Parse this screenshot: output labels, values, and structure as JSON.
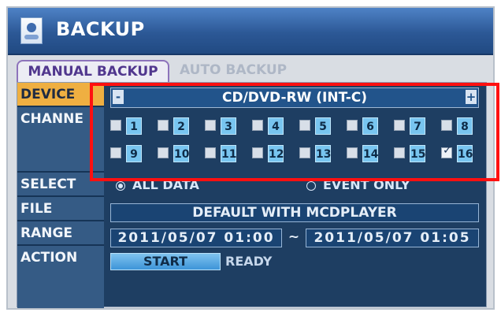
{
  "window": {
    "title": "BACKUP"
  },
  "tabs": [
    {
      "label": "MANUAL BACKUP"
    },
    {
      "label": "AUTO BACKUP"
    }
  ],
  "labels": {
    "device": "DEVICE",
    "channel": "CHANNE",
    "select": "SELECT",
    "file": "FILE",
    "range": "RANGE",
    "action": "ACTION"
  },
  "device": {
    "value": "CD/DVD-RW (INT-C)",
    "minus": "-",
    "plus": "+"
  },
  "channels": {
    "row1": [
      {
        "number": "1",
        "checked": false
      },
      {
        "number": "2",
        "checked": false
      },
      {
        "number": "3",
        "checked": false
      },
      {
        "number": "4",
        "checked": false
      },
      {
        "number": "5",
        "checked": false
      },
      {
        "number": "6",
        "checked": false
      },
      {
        "number": "7",
        "checked": false
      },
      {
        "number": "8",
        "checked": false
      }
    ],
    "row2": [
      {
        "number": "9",
        "checked": false
      },
      {
        "number": "10",
        "checked": false
      },
      {
        "number": "11",
        "checked": false
      },
      {
        "number": "12",
        "checked": false
      },
      {
        "number": "13",
        "checked": false
      },
      {
        "number": "14",
        "checked": false
      },
      {
        "number": "15",
        "checked": false
      },
      {
        "number": "16",
        "checked": true
      }
    ]
  },
  "select": {
    "all_data": "ALL DATA",
    "event_only": "EVENT ONLY"
  },
  "file": {
    "value": "DEFAULT WITH MCDPLAYER"
  },
  "range": {
    "start": "2011/05/07 01:00",
    "separator": "~",
    "end": "2011/05/07 01:05"
  },
  "action": {
    "button": "START",
    "status": "READY"
  }
}
